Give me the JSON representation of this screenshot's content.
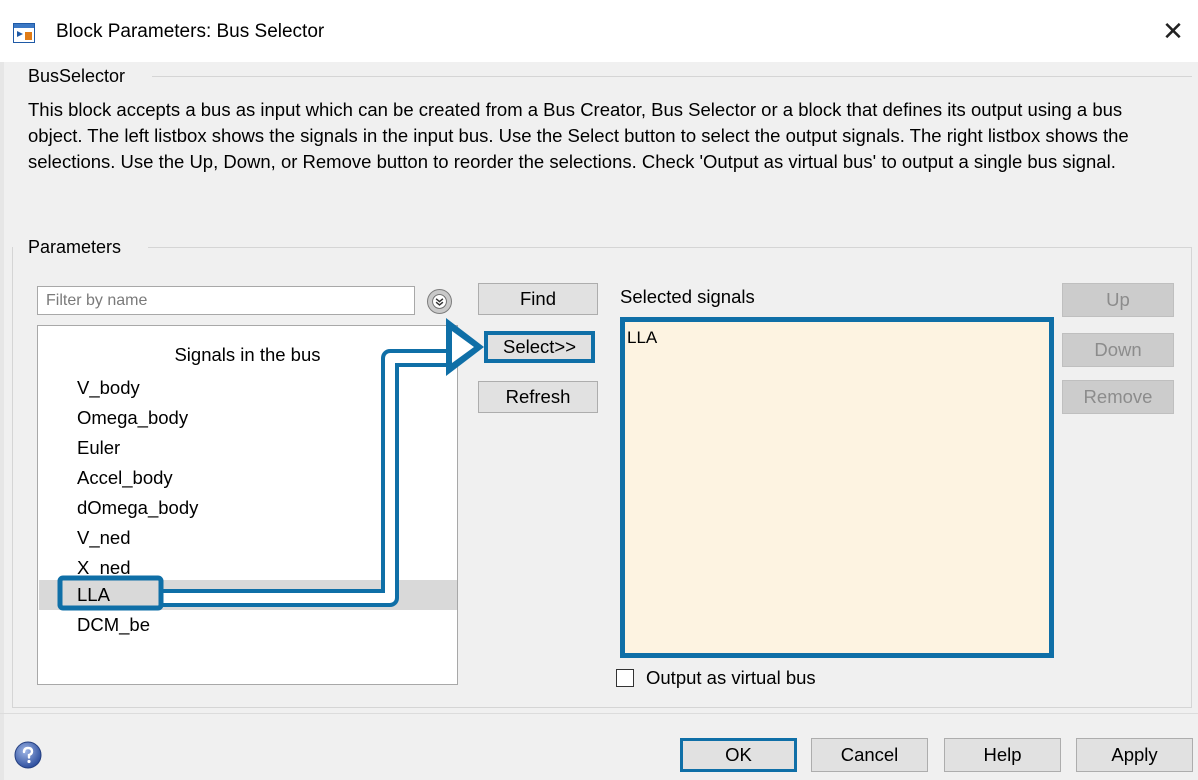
{
  "window": {
    "title": "Block Parameters: Bus Selector",
    "close_glyph": "✕"
  },
  "block_group": {
    "label": "BusSelector",
    "description": "This block accepts a bus as input which can be created from a Bus Creator, Bus Selector or a block that defines its output using a bus object. The left listbox shows the signals in the input bus. Use the Select button to select the output signals. The right listbox shows the selections. Use the Up, Down, or Remove button to reorder the selections. Check 'Output as virtual bus' to output a single bus signal."
  },
  "parameters": {
    "label": "Parameters",
    "filter": {
      "placeholder": "Filter by name",
      "value": ""
    },
    "buttons": {
      "find": "Find",
      "select": "Select>>",
      "refresh": "Refresh"
    },
    "signals": {
      "header": "Signals in the bus",
      "items": [
        "V_body",
        "Omega_body",
        "Euler",
        "Accel_body",
        "dOmega_body",
        "V_ned",
        "X_ned",
        "LLA",
        "DCM_be"
      ],
      "selected_item": "LLA"
    },
    "selected_signals": {
      "label": "Selected signals",
      "items": [
        "LLA"
      ]
    },
    "order_buttons": {
      "up": "Up",
      "down": "Down",
      "remove": "Remove"
    },
    "output_virtual_bus": {
      "label": "Output as virtual bus",
      "checked": false
    }
  },
  "footer": {
    "ok": "OK",
    "cancel": "Cancel",
    "help": "Help",
    "apply": "Apply"
  },
  "colors": {
    "highlight": "#0f6fa7",
    "selected_list_bg": "#fdf3e1",
    "dialog_bg": "#f0f0f0"
  },
  "icons": {
    "app": "simulink-block-icon",
    "filter_options": "chevron-down-circle-icon",
    "help": "help-question-icon",
    "close": "close-icon"
  }
}
